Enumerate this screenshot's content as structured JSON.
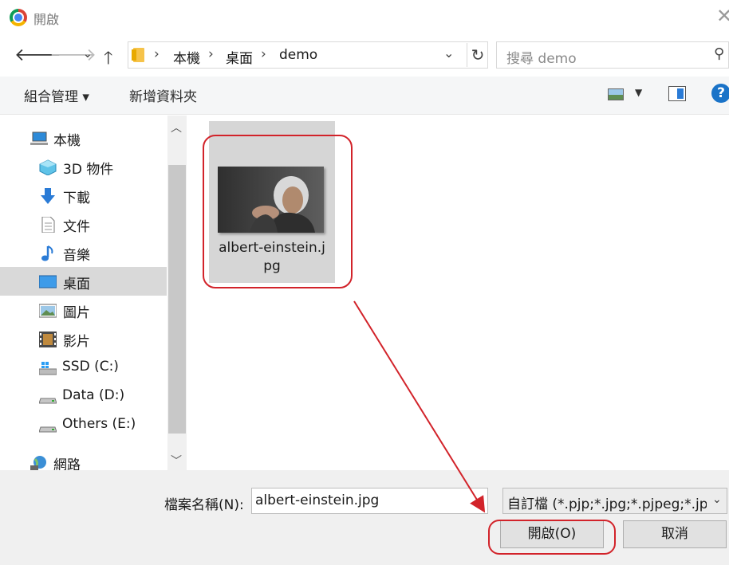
{
  "window": {
    "title": "開啟"
  },
  "address_bar": {
    "breadcrumbs": [
      "本機",
      "桌面",
      "demo"
    ],
    "separator": "›"
  },
  "search": {
    "placeholder": "搜尋 demo"
  },
  "toolbar": {
    "organize": "組合管理 ▾",
    "new_folder": "新增資料夾"
  },
  "nav_pane": {
    "items": [
      {
        "label": "本機",
        "icon": "computer-icon"
      },
      {
        "label": "3D 物件",
        "icon": "3d-objects-icon"
      },
      {
        "label": "下載",
        "icon": "download-icon"
      },
      {
        "label": "文件",
        "icon": "document-icon"
      },
      {
        "label": "音樂",
        "icon": "music-icon"
      },
      {
        "label": "桌面",
        "icon": "desktop-icon",
        "selected": true
      },
      {
        "label": "圖片",
        "icon": "pictures-icon"
      },
      {
        "label": "影片",
        "icon": "videos-icon"
      },
      {
        "label": "SSD (C:)",
        "icon": "windows-drive-icon"
      },
      {
        "label": "Data (D:)",
        "icon": "drive-icon"
      },
      {
        "label": "Others (E:)",
        "icon": "drive-icon"
      },
      {
        "label": "網路",
        "icon": "network-icon"
      }
    ]
  },
  "files": [
    {
      "name": "albert-einstein.jpg",
      "selected": true
    }
  ],
  "footer": {
    "filename_label": "檔案名稱(N):",
    "filename_value": "albert-einstein.jpg",
    "filter_value": "自訂檔 (*.pjp;*.jpg;*.pjpeg;*.jpeg",
    "open_button": "開啟(O)",
    "cancel_button": "取消"
  },
  "colors": {
    "annotation": "#d2232a",
    "selection": "#d6d6d6",
    "accent": "#1a73c8"
  }
}
